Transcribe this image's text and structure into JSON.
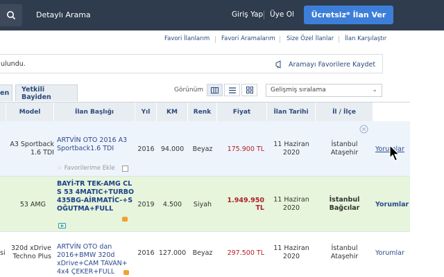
{
  "header": {
    "detailed_search": "Detaylı Arama",
    "login": "Giriş Yap",
    "register": "Üye Ol",
    "free_ad_bold": "Ücretsiz*",
    "free_ad_rest": "İlan Ver"
  },
  "sublinks": [
    "Favori İlanlarım",
    "Favori Aramalarım",
    "Size Özel İlanlar",
    "İlan Karşılaştır"
  ],
  "result": {
    "text": "ulundu.",
    "save_search": "Aramayı Favorilere Kaydet"
  },
  "tabs": [
    "en",
    "Yetkili Bayiden"
  ],
  "view": {
    "label": "Görünüm",
    "sort_value": "Gelişmiş sıralama"
  },
  "table": {
    "headers": [
      "Model",
      "İlan Başlığı",
      "Yıl",
      "KM",
      "Renk",
      "Fiyat",
      "İlan Tarihi",
      "İl / İlçe"
    ],
    "rows": [
      {
        "model": "A3 Sportback 1.6 TDI",
        "title": "ARTVİN OTO 2016 A3 Sportback1.6 TDI",
        "year": "2016",
        "km": "94.000",
        "color": "Beyaz",
        "price": "175.900 TL",
        "date": "11 Haziran 2020",
        "city": "İstanbul",
        "district": "Ataşehir",
        "comments": "Yorumlar",
        "fav": "Favorilerime Ekle"
      },
      {
        "model": "53 AMG",
        "title": "BAYİ-TR TEK-AMG CLS 53 4MATIC+TURBO 435BG-AİRMATİC-+SOĞUTMA+FULL",
        "year": "2019",
        "km": "4.500",
        "color": "Siyah",
        "price": "1.949.950 TL",
        "date": "11 Haziran 2020",
        "city": "İstanbul",
        "district": "Bağcılar",
        "comments": "Yorumlar"
      },
      {
        "model_prefix": "si",
        "model": "320d xDrive Techno Plus",
        "title": "ARTVİN OTO dan 2016+BMW 320d xDrive+CAM TAVAN+ 4x4 ÇEKER+FULL",
        "year": "2016",
        "km": "127.000",
        "color": "Beyaz",
        "price": "297.500 TL",
        "date": "11 Haziran 2020",
        "city": "İstanbul",
        "district": "Ataşehir",
        "comments": "Yorumlar"
      }
    ]
  },
  "colors": {
    "topbar": "#2f3c4e",
    "accent": "#3d7ed9",
    "price": "#b0202a",
    "featured_row": "#e6f5db",
    "hover_row": "#eef4fb"
  }
}
